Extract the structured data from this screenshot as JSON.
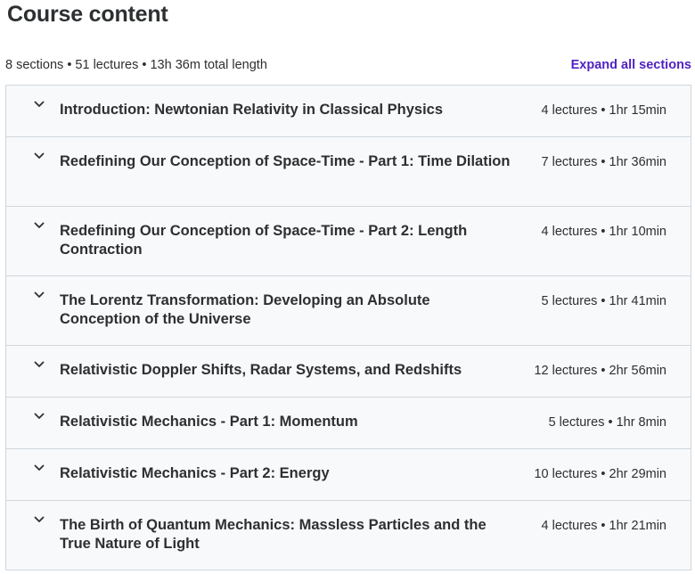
{
  "header": {
    "title": "Course content",
    "summary": "8 sections • 51 lectures • 13h 36m total length",
    "expand_label": "Expand all sections"
  },
  "icons": {
    "section_toggle": "chevron-down-icon"
  },
  "colors": {
    "accent": "#5022c3",
    "section_bg": "#f7f9fa",
    "border": "#d1d7dc",
    "text": "#2d2f31"
  },
  "sections": [
    {
      "title": "Introduction: Newtonian Relativity in Classical Physics",
      "meta": "4 lectures • 1hr 15min"
    },
    {
      "title": "Redefining Our Conception of Space-Time - Part 1: Time Dilation",
      "meta": "7 lectures • 1hr 36min"
    },
    {
      "title": "Redefining Our Conception of Space-Time - Part 2: Length Contraction",
      "meta": "4 lectures • 1hr 10min"
    },
    {
      "title": "The Lorentz Transformation: Developing an Absolute Conception of the Universe",
      "meta": "5 lectures • 1hr 41min"
    },
    {
      "title": "Relativistic Doppler Shifts, Radar Systems, and Redshifts",
      "meta": "12 lectures • 2hr 56min"
    },
    {
      "title": "Relativistic Mechanics - Part 1: Momentum",
      "meta": "5 lectures • 1hr 8min"
    },
    {
      "title": "Relativistic Mechanics - Part 2: Energy",
      "meta": "10 lectures • 2hr 29min"
    },
    {
      "title": "The Birth of Quantum Mechanics: Massless Particles and the True Nature of Light",
      "meta": "4 lectures • 1hr 21min"
    }
  ]
}
